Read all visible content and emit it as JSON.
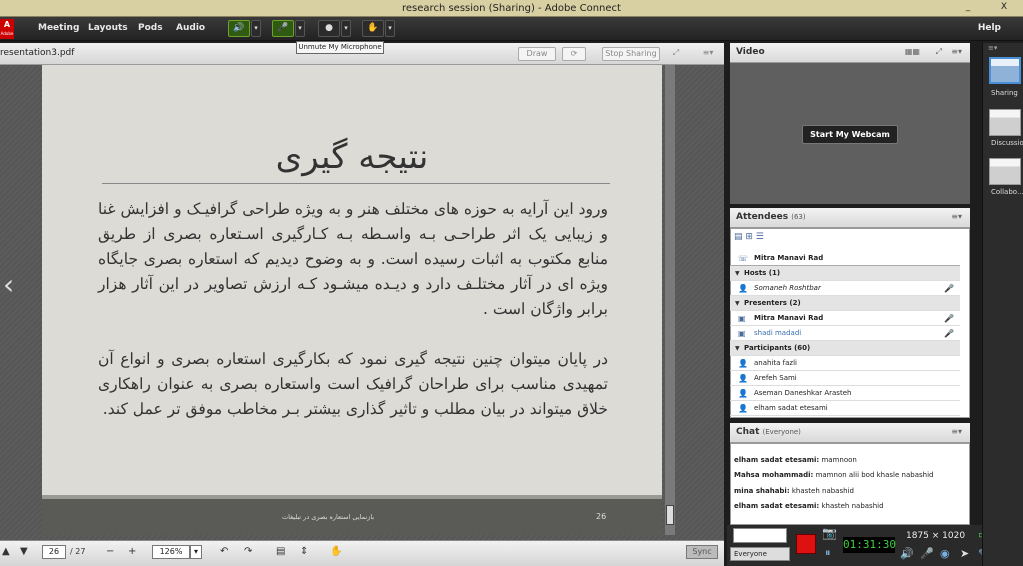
{
  "window": {
    "title": "research session (Sharing) - Adobe Connect",
    "minimize": "_",
    "close": "X"
  },
  "menubar": {
    "logo": "A",
    "logo_sub": "Adobe",
    "items": [
      "Meeting",
      "Layouts",
      "Pods",
      "Audio"
    ],
    "help": "Help",
    "tooltip": "Unmute My Microphone"
  },
  "share": {
    "filename": "resentation3.pdf",
    "draw_label": "Draw",
    "stop_sharing_label": "Stop Sharing",
    "slide": {
      "title": "نتیجه گیری",
      "para1": "ورود این آرایه به حوزه های مختلف هنر و به ویژه طراحی گرافیـک و افزایش غنا و زیبایی یک اثر طراحـی بـه واسـطه بـه کـارگیری اسـتعاره بصری از طریق منابع مکتوب به اثبات رسیده است. و به وضوح دیدیم که استعاره بصری جایگاه ویژه ای در آثار مختلـف دارد و دیـده میشـود کـه ارزش تصاویر در این آثار هزار برابر واژگان است .",
      "para2": "در پایان میتوان چنین نتیجه گیری نمود که بکارگیری استعاره بصری و انواع آن تمهیدی مناسب برای طراحان گرافیک است  واستعاره بصری به عنوان راهکاری خلاق میتواند در بیان مطلب و تاثیر گذاری بیشتر بـر مخاطب موفق تر عمل کند.",
      "footer": "بازنمایی استعاره بصری در تبلیغات",
      "number": "26"
    },
    "toolbar": {
      "page_current": "26",
      "page_total": "/ 27",
      "zoom": "126%",
      "sync_label": "Sync"
    }
  },
  "video": {
    "title": "Video",
    "webcam_label": "Start My Webcam"
  },
  "attendees": {
    "title": "Attendees",
    "count": "(63)",
    "self": "Mitra Manavi Rad",
    "hosts": {
      "label": "Hosts (1)",
      "items": [
        "Somaneh Roshtbar"
      ]
    },
    "presenters": {
      "label": "Presenters (2)",
      "items": [
        "Mitra Manavi Rad",
        "shadi madadi"
      ]
    },
    "participants": {
      "label": "Participants (60)",
      "items": [
        "anahita fazli",
        "Arefeh Sami",
        "Aseman Daneshkar Arasteh",
        "elham sadat etesami"
      ]
    }
  },
  "chat": {
    "title": "Chat",
    "scope": "(Everyone)",
    "messages": [
      {
        "author": "elham sadat etesami:",
        "text": "mamnoon"
      },
      {
        "author": "Mahsa mohammadi:",
        "text": "mamnon alii bod khasle nabashid"
      },
      {
        "author": "mina shahabi:",
        "text": "khasteh nabashid"
      },
      {
        "author": "elham sadat etesami:",
        "text": "khasteh nabashid"
      }
    ],
    "recipient": "Everyone"
  },
  "recorder": {
    "timer": "01:31:30",
    "resolution": "1875 × 1020"
  },
  "layouts": [
    "Sharing",
    "Discussio",
    "Collabo..."
  ],
  "colors": {
    "accent": "#4a90d8",
    "record": "#d11111",
    "timer": "#3fd13f"
  }
}
